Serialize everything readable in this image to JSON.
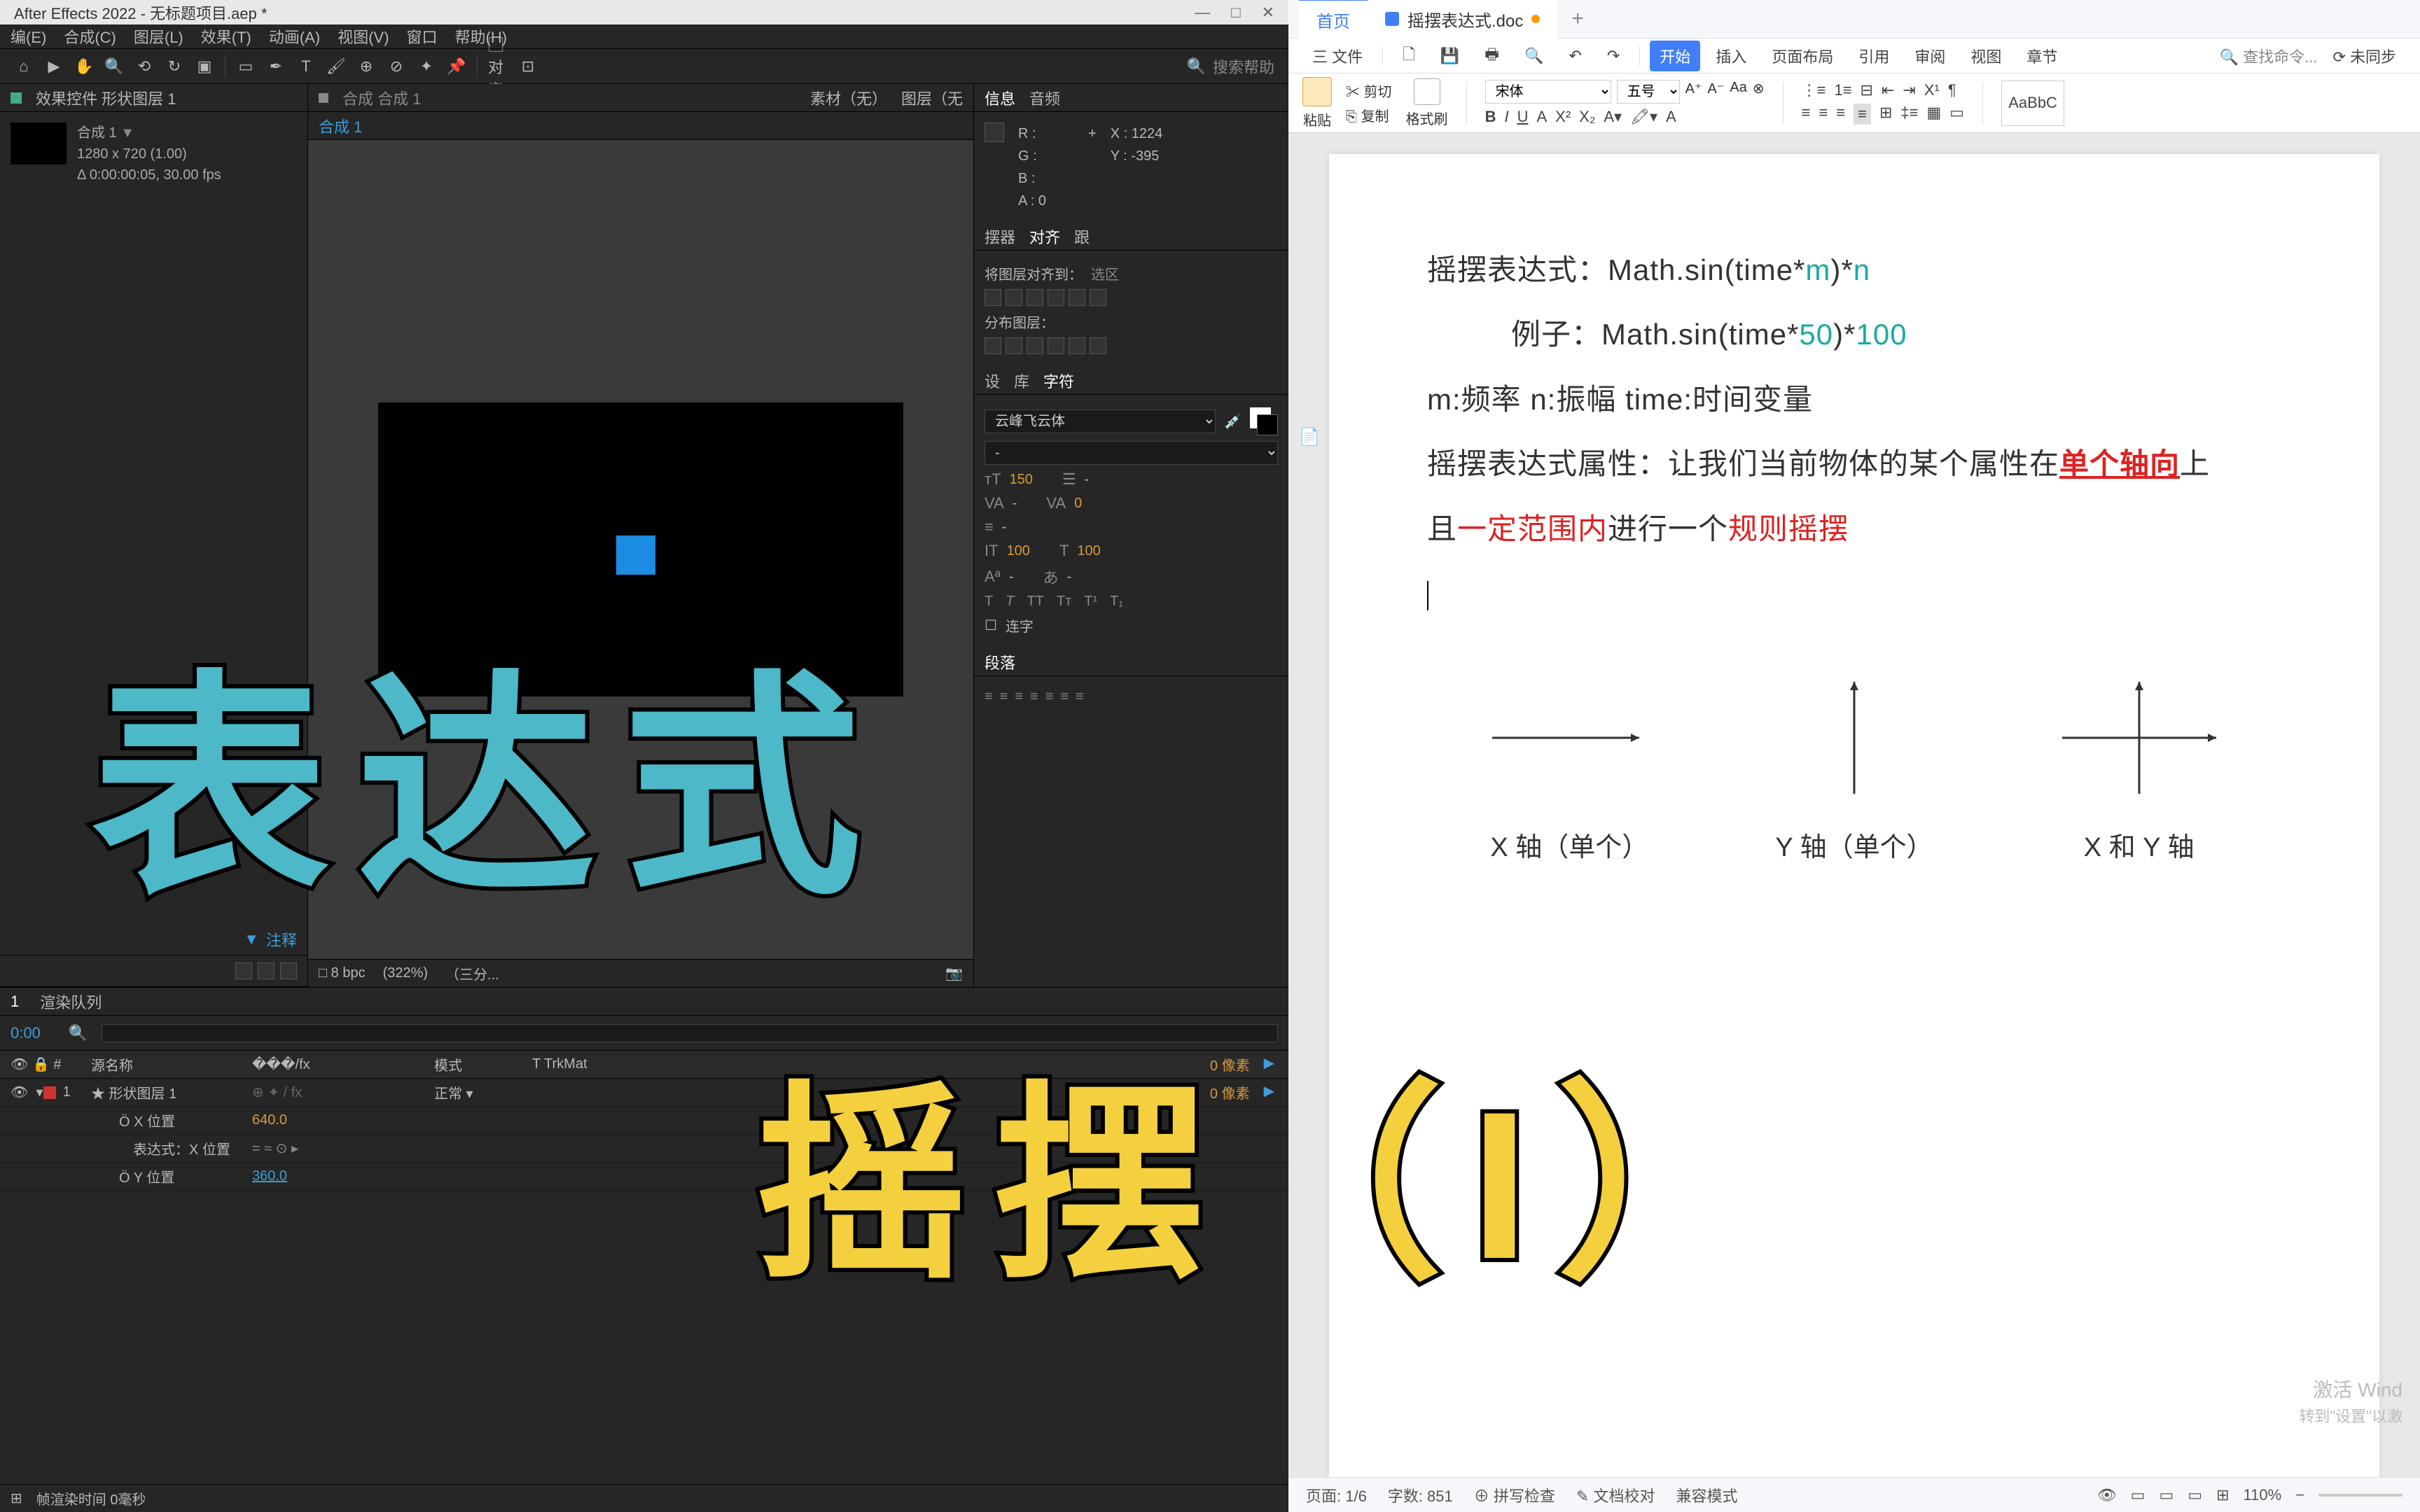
{
  "ae": {
    "title": "After Effects 2022 - 无标题项目.aep *",
    "menu": [
      "编(E)",
      "合成(C)",
      "图层(L)",
      "效果(T)",
      "动画(A)",
      "视图(V)",
      "窗口",
      "帮助(H)"
    ],
    "search": "搜索帮助",
    "project_tab": "效果控件 形状图层 1",
    "comp_name": "合成 1",
    "comp_meta1": "1280 x 720 (1.00)",
    "comp_meta2": "Δ 0:00:00:05, 30.00 fps",
    "annot_label": "注释",
    "center_tabs": {
      "comp": "合成 合成 1",
      "active": "合成 1",
      "material": "素材（无）",
      "layer": "图层（无"
    },
    "viewer_zoom": "(322%)",
    "viewer_res": "（三分...",
    "info_tab": "信息",
    "audio_tab": "音频",
    "info_r": "R :",
    "info_g": "G :",
    "info_b": "B :",
    "info_a": "A : 0",
    "info_x": "X : 1224",
    "info_y": "Y : -395",
    "swing_tab": "摆器",
    "align_tab": "对齐",
    "track_tab": "跟",
    "align_label": "将图层对齐到：",
    "align_sel": "选区",
    "dist_label": "分布图层：",
    "set_tab": "设",
    "lib_tab": "库",
    "char_tab": "字符",
    "font_name": "云峰飞云体",
    "font_size": "150",
    "leading": "-",
    "tracking": "-",
    "kerning": "0",
    "scale": "100",
    "baseline": "-",
    "stroke": "-",
    "ligature": "连字",
    "para_tab": "段落",
    "tl_tab1": "1",
    "tl_tab2": "渲染队列",
    "tl_time": "0:00",
    "tl_cols": {
      "num": "#",
      "src": "源名称",
      "switches": "���/fx",
      "mode": "模式",
      "trkmat": "T  TrkMat"
    },
    "layer1": {
      "num": "1",
      "name": "★ 形状图层 1",
      "mode": "正常"
    },
    "xpos_label": "Ö X 位置",
    "xpos_val": "640.0",
    "expr_label": "表达式：X 位置",
    "ypos_label": "Ö Y 位置",
    "ypos_val": "360.0",
    "tl_offset1": "0 像素",
    "tl_offset2": "0 像素",
    "render_time": "帧渲染时间 0毫秒"
  },
  "wps": {
    "home_tab": "首页",
    "doc_tab": "摇摆表达式.doc",
    "menu_file": "三 文件",
    "ribbon": [
      "开始",
      "插入",
      "页面布局",
      "引用",
      "审阅",
      "视图",
      "章节"
    ],
    "search": "查找命令...",
    "sync": "未同步",
    "paste": "粘贴",
    "cut": "剪切",
    "copy": "复制",
    "fmt": "格式刷",
    "font": "宋体",
    "size": "五号",
    "doc": {
      "l1a": "摇摆表达式：Math.sin(time*",
      "l1m": "m",
      "l1b": ")*",
      "l1n": "n",
      "l2a": "例子：Math.sin(time*",
      "l2m": "50",
      "l2b": ")*",
      "l2n": "100",
      "l3": "m:频率  n:振幅  time:时间变量",
      "l4a": "摇摆表达式属性：让我们当前物体的某个属性在",
      "l4b": "单个轴向",
      "l4c": "上",
      "l5a": "且",
      "l5b": "一定范围内",
      "l5c": "进行一个",
      "l5d": "规则摇摆",
      "ax1": "X 轴（单个）",
      "ax2": "Y 轴（单个）",
      "ax3": "X 和 Y 轴"
    },
    "status": {
      "page": "页面: 1/6",
      "words": "字数: 851",
      "spell": "拼写检查",
      "proof": "文档校对",
      "compat": "兼容模式",
      "zoom": "110%"
    },
    "activate1": "激活 Wind",
    "activate2": "转到\"设置\"以激"
  },
  "overlay": {
    "t1": "表达式",
    "t2": "摇摆（I）"
  }
}
